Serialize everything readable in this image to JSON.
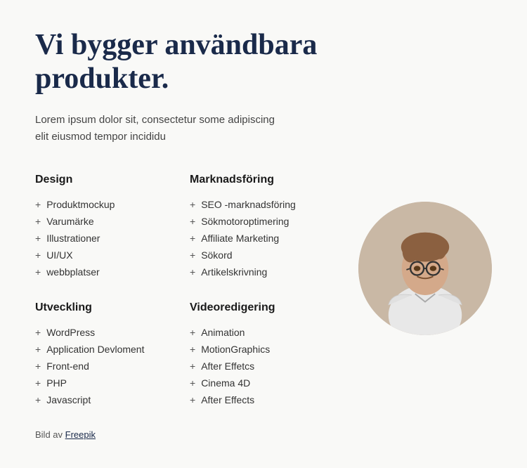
{
  "heading": "Vi bygger användbara produkter.",
  "subtitle": "Lorem ipsum dolor sit, consectetur some adipiscing elit eiusmod tempor incididu",
  "sections": [
    {
      "id": "design",
      "title": "Design",
      "items": [
        "Produktmockup",
        "Varumärke",
        "Illustrationer",
        "UI/UX",
        "webbplatser"
      ]
    },
    {
      "id": "marknadsföring",
      "title": "Marknadsföring",
      "items": [
        "SEO -marknadsföring",
        "Sökmotoroptimering",
        "Affiliate Marketing",
        "Sökord",
        "Artikelskrivning"
      ]
    },
    {
      "id": "utveckling",
      "title": "Utveckling",
      "items": [
        "WordPress",
        "Application Devloment",
        "Front-end",
        "PHP",
        "Javascript"
      ]
    },
    {
      "id": "videoredigering",
      "title": "Videoredigering",
      "items": [
        "Animation",
        "MotionGraphics",
        "After Effetcs",
        "Cinema 4D",
        "After Effects"
      ]
    }
  ],
  "footer": {
    "text": "Bild av ",
    "link_text": "Freepik",
    "link_url": "#"
  },
  "plus_symbol": "+"
}
